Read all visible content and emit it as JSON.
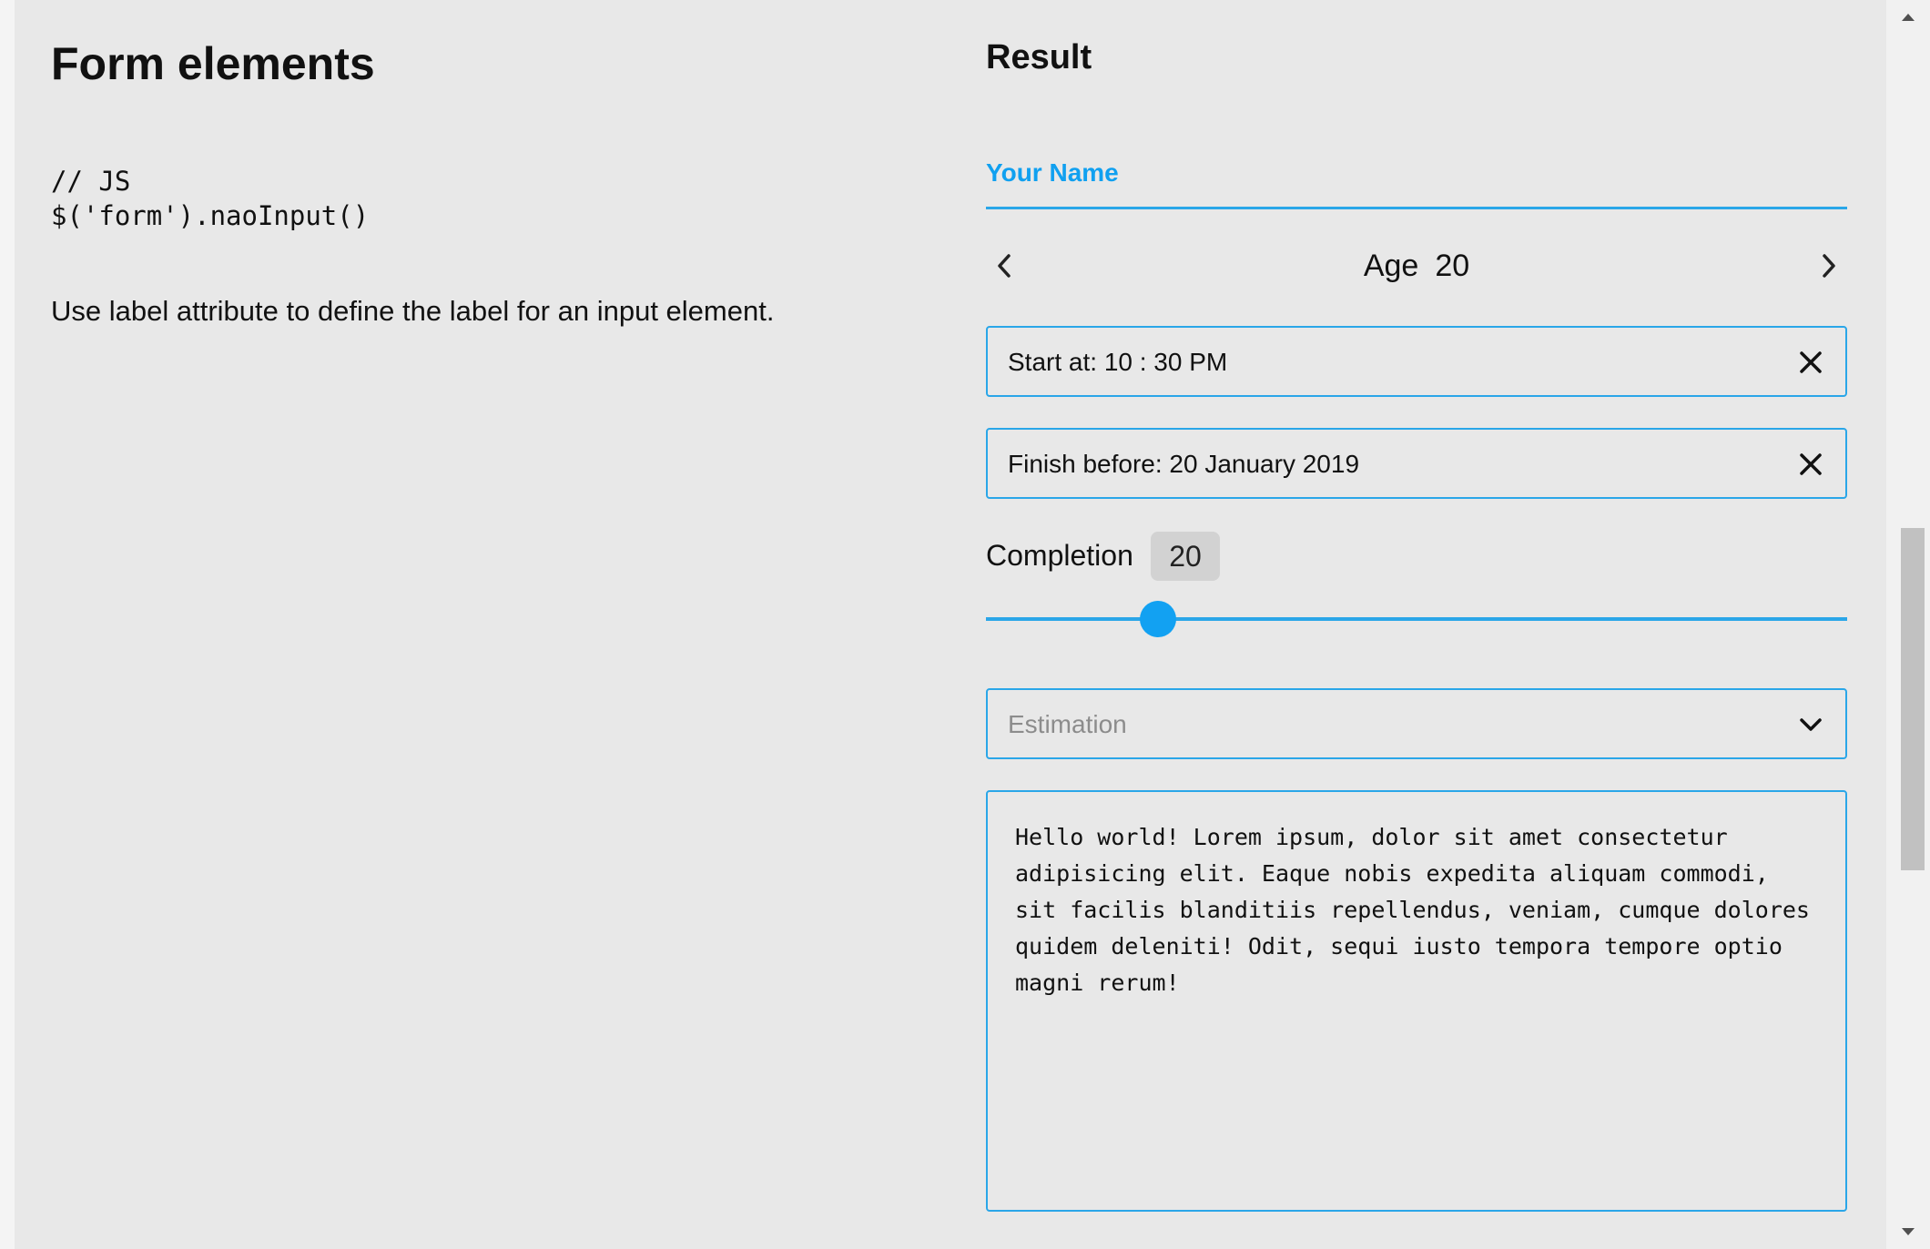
{
  "doc": {
    "title": "Form elements",
    "code_lines": [
      "// JS",
      "$('form').naoInput()"
    ],
    "description": "Use label attribute to define the label for an input element."
  },
  "result": {
    "title": "Result",
    "name_field": {
      "label": "Your Name",
      "value": ""
    },
    "age": {
      "label": "Age",
      "value": "20",
      "prev_icon": "chevron-left-icon",
      "next_icon": "chevron-right-icon"
    },
    "start": {
      "text": "Start at: 10 : 30 PM",
      "clear_icon": "close-icon"
    },
    "finish": {
      "text": "Finish before: 20 January 2019",
      "clear_icon": "close-icon"
    },
    "completion": {
      "label": "Completion",
      "value": "20",
      "fraction": 0.2
    },
    "estimation": {
      "placeholder": "Estimation",
      "icon": "chevron-down-icon"
    },
    "textarea": {
      "value": "Hello world! Lorem ipsum, dolor sit amet consectetur adipisicing elit. Eaque nobis expedita aliquam commodi, sit facilis blanditiis repellendus, veniam, cumque dolores quidem deleniti! Odit, sequi iusto tempora tempore optio magni rerum!"
    }
  },
  "colors": {
    "accent": "#12a1f2",
    "border": "#2aa6e8",
    "background": "#e8e8e8",
    "badge": "#d2d2d2"
  }
}
